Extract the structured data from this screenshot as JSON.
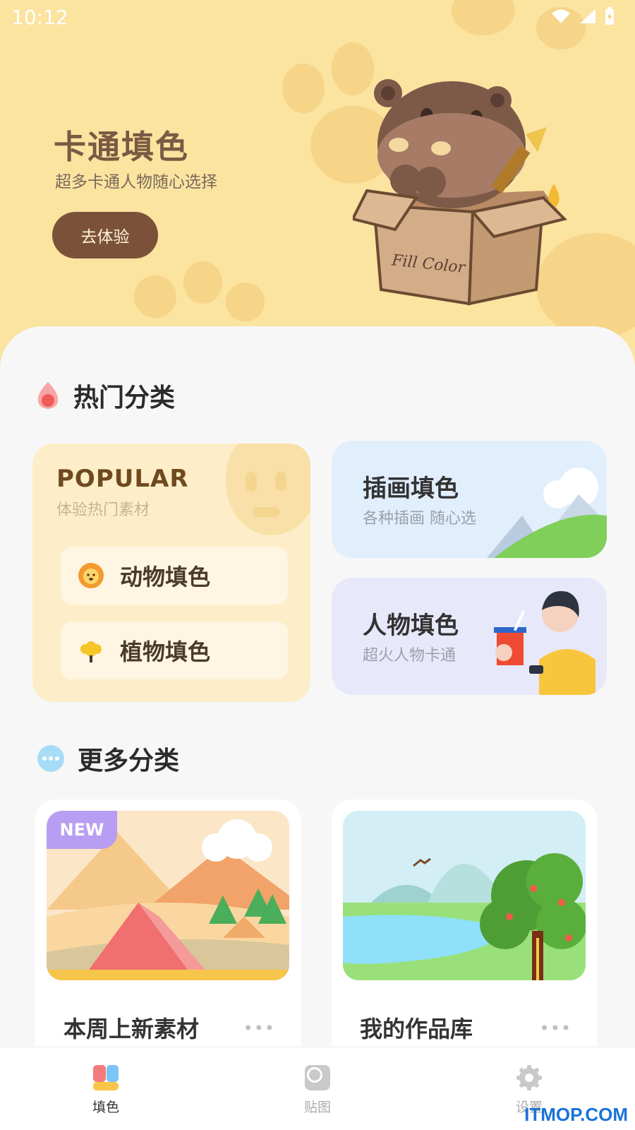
{
  "status_bar": {
    "time": "10:12"
  },
  "hero": {
    "title": "卡通填色",
    "subtitle": "超多卡通人物随心选择",
    "button_label": "去体验",
    "box_text": "Fill Color"
  },
  "hot_section": {
    "title": "热门分类",
    "popular": {
      "title": "POPULAR",
      "subtitle": "体验热门素材",
      "items": [
        {
          "label": "动物填色",
          "icon": "lion-icon"
        },
        {
          "label": "植物填色",
          "icon": "flower-icon"
        }
      ]
    },
    "side_cards": [
      {
        "title": "插画填色",
        "subtitle": "各种插画 随心选"
      },
      {
        "title": "人物填色",
        "subtitle": "超火人物卡通"
      }
    ]
  },
  "more_section": {
    "title": "更多分类",
    "cards": [
      {
        "label": "本周上新素材",
        "badge": "NEW",
        "menu": "•••"
      },
      {
        "label": "我的作品库",
        "menu": "•••"
      }
    ]
  },
  "tabbar": {
    "tabs": [
      {
        "label": "填色",
        "active": true
      },
      {
        "label": "贴图",
        "active": false
      },
      {
        "label": "设置",
        "active": false
      }
    ]
  },
  "watermark": "ITMOP.COM",
  "colors": {
    "hero_bg": "#fbe3a0",
    "hero_button": "#7b5239",
    "popular_bg": "#fdeec9",
    "illustration_bg": "#e1eefc",
    "person_bg": "#e8e8fb",
    "new_badge": "#b79ef2"
  }
}
